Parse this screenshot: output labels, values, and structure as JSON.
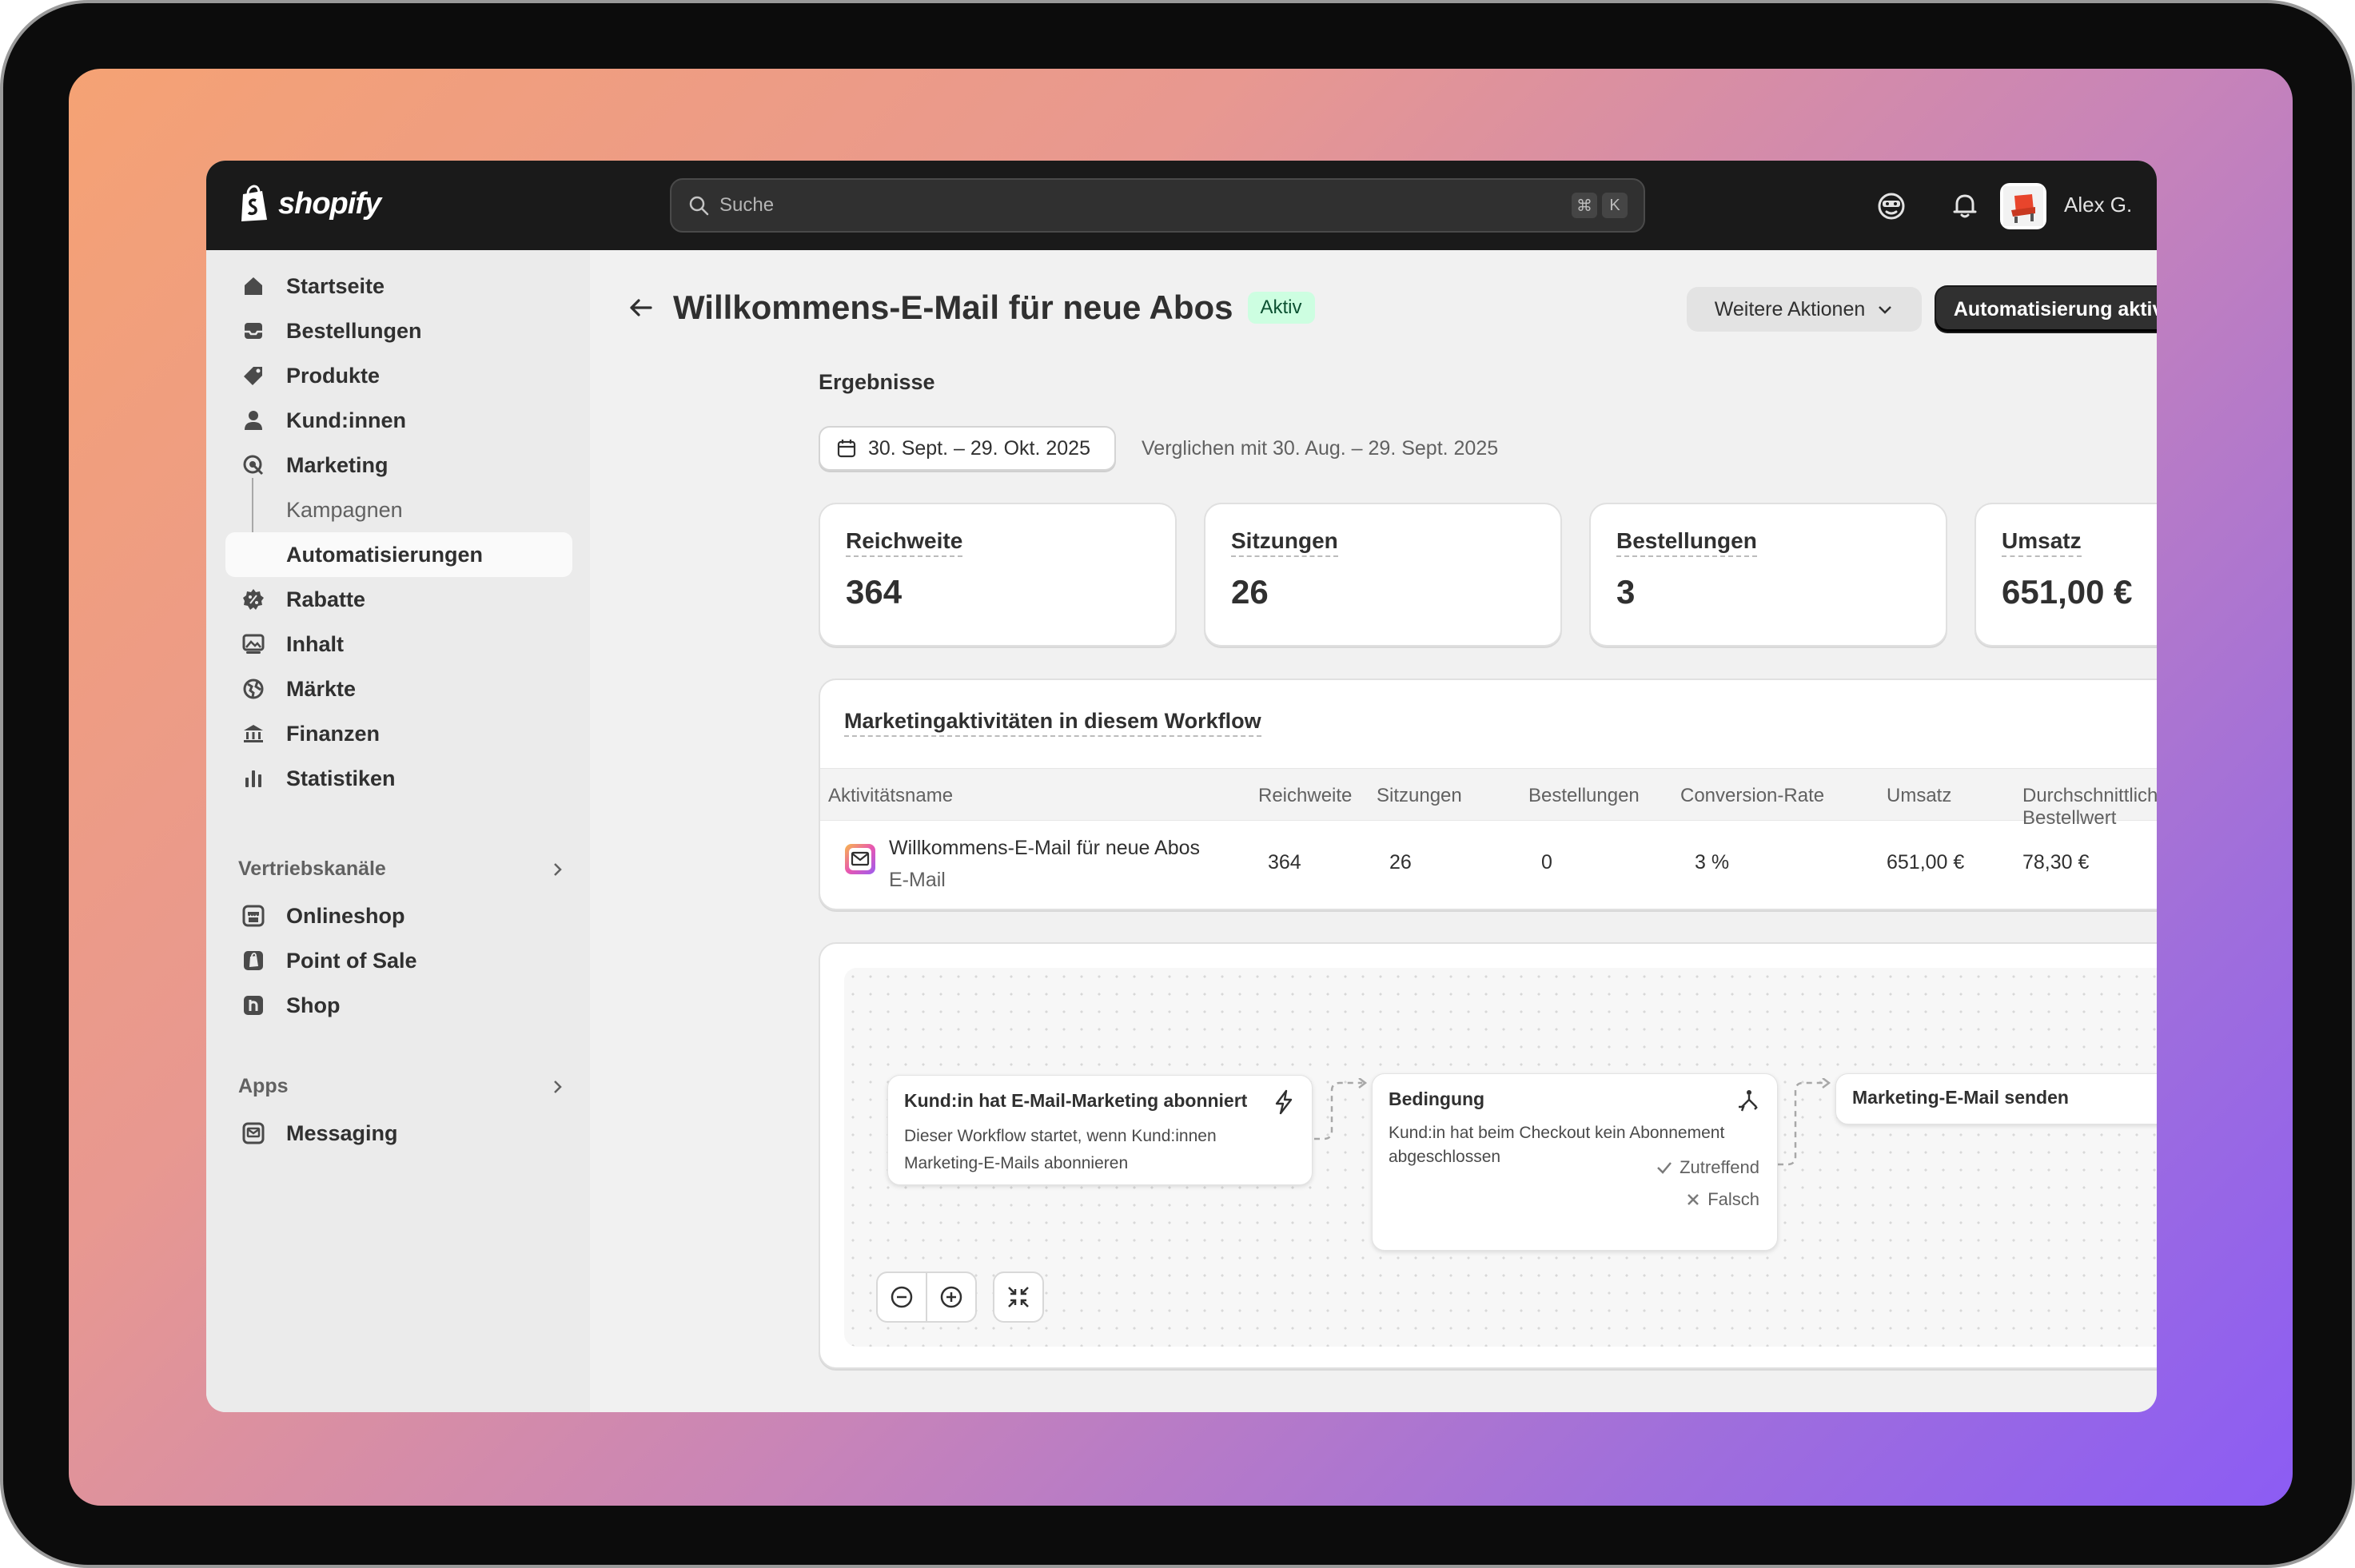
{
  "brand": {
    "name": "shopify"
  },
  "search": {
    "placeholder": "Suche",
    "shortcut": [
      "⌘",
      "K"
    ]
  },
  "user": {
    "name": "Alex G."
  },
  "sidebar": {
    "items": [
      {
        "label": "Startseite",
        "icon": "home-icon"
      },
      {
        "label": "Bestellungen",
        "icon": "inbox-icon"
      },
      {
        "label": "Produkte",
        "icon": "tag-icon"
      },
      {
        "label": "Kund:innen",
        "icon": "person-icon"
      },
      {
        "label": "Marketing",
        "icon": "target-icon"
      },
      {
        "label": "Kampagnen",
        "icon": ""
      },
      {
        "label": "Automatisierungen",
        "icon": ""
      },
      {
        "label": "Rabatte",
        "icon": "discount-icon"
      },
      {
        "label": "Inhalt",
        "icon": "image-icon"
      },
      {
        "label": "Märkte",
        "icon": "globe-icon"
      },
      {
        "label": "Finanzen",
        "icon": "bank-icon"
      },
      {
        "label": "Statistiken",
        "icon": "bar-chart-icon"
      }
    ],
    "sales_channels": {
      "heading": "Vertriebskanäle",
      "items": [
        {
          "label": "Onlineshop",
          "icon": "store-icon"
        },
        {
          "label": "Point of Sale",
          "icon": "pos-icon"
        },
        {
          "label": "Shop",
          "icon": "shop-icon"
        }
      ]
    },
    "apps": {
      "heading": "Apps",
      "items": [
        {
          "label": "Messaging",
          "icon": "mail-icon"
        }
      ]
    }
  },
  "page": {
    "title": "Willkommens-E-Mail für neue Abos",
    "status": "Aktiv",
    "more_actions": "Weitere Aktionen",
    "primary_action": "Automatisierung aktivieren",
    "results_heading": "Ergebnisse",
    "date_range": "30. Sept. – 29. Okt. 2025",
    "compare_text": "Verglichen mit 30. Aug. – 29. Sept. 2025"
  },
  "metrics": [
    {
      "label": "Reichweite",
      "value": "364"
    },
    {
      "label": "Sitzungen",
      "value": "26"
    },
    {
      "label": "Bestellungen",
      "value": "3"
    },
    {
      "label": "Umsatz",
      "value": "651,00 €"
    }
  ],
  "activities": {
    "title": "Marketingaktivitäten in diesem Workflow",
    "columns": [
      "Aktivitätsname",
      "Reichweite",
      "Sitzungen",
      "Bestellungen",
      "Conversion-Rate",
      "Umsatz",
      "Durchschnittlicher Bestellwert"
    ],
    "rows": [
      {
        "name": "Willkommens-E-Mail für neue Abos",
        "type": "E-Mail",
        "reach": "364",
        "sessions": "26",
        "orders": "0",
        "conversion": "3 %",
        "revenue": "651,00 €",
        "aov": "78,30 €"
      }
    ]
  },
  "workflow": {
    "trigger": {
      "title": "Kund:in hat E-Mail-Marketing abonniert",
      "description": "Dieser Workflow startet, wenn Kund:innen Marketing-E-Mails abonnieren"
    },
    "condition": {
      "title": "Bedingung",
      "description": "Kund:in hat beim Checkout kein Abonnement abgeschlossen",
      "true_label": "Zutreffend",
      "false_label": "Falsch"
    },
    "action": {
      "title": "Marketing-E-Mail senden"
    }
  },
  "colors": {
    "topbar": "#1a1a1a",
    "badge_bg": "#cdfee1",
    "badge_text": "#0c5132",
    "primary": "#303030"
  }
}
